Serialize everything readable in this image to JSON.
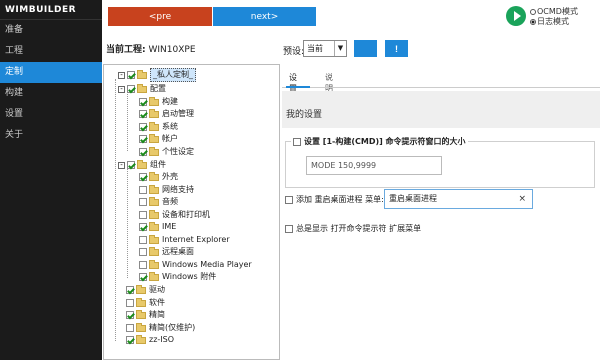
{
  "app": {
    "title": "WIMBUILDER"
  },
  "sidebar": {
    "items": [
      {
        "label": "准备",
        "active": false
      },
      {
        "label": "工程",
        "active": false
      },
      {
        "label": "定制",
        "active": true
      },
      {
        "label": "构建",
        "active": false
      },
      {
        "label": "设置",
        "active": false
      },
      {
        "label": "关于",
        "active": false
      }
    ]
  },
  "toolbar": {
    "pre_label": "<pre",
    "next_label": "next>",
    "project_label": "当前工程:",
    "project_value": "WIN10XPE",
    "preset_label": "预设:",
    "preset_value": "当前",
    "btn2_label": "!"
  },
  "mode": {
    "options": [
      {
        "label": "OCMD模式",
        "selected": false
      },
      {
        "label": "日志模式",
        "selected": true
      }
    ]
  },
  "tree": {
    "nodes": [
      {
        "label": "_私人定制_",
        "checked": true,
        "selected": true
      },
      {
        "label": "配置",
        "checked": true
      },
      {
        "label": "构建",
        "checked": true
      },
      {
        "label": "启动管理",
        "checked": true
      },
      {
        "label": "系统",
        "checked": true
      },
      {
        "label": "帐户",
        "checked": true
      },
      {
        "label": "个性设定",
        "checked": true
      },
      {
        "label": "组件",
        "checked": true
      },
      {
        "label": "外壳",
        "checked": true
      },
      {
        "label": "网络支持",
        "checked": false
      },
      {
        "label": "音频",
        "checked": false
      },
      {
        "label": "设备和打印机",
        "checked": false
      },
      {
        "label": "IME",
        "checked": true
      },
      {
        "label": "Internet Explorer",
        "checked": false
      },
      {
        "label": "远程桌面",
        "checked": false
      },
      {
        "label": "Windows Media Player",
        "checked": false
      },
      {
        "label": "Windows 附件",
        "checked": true
      },
      {
        "label": "驱动",
        "checked": true
      },
      {
        "label": "软件",
        "checked": false
      },
      {
        "label": "精简",
        "checked": true
      },
      {
        "label": "精简(仅维护)",
        "checked": false
      },
      {
        "label": "zz-ISO",
        "checked": true
      }
    ]
  },
  "panel": {
    "tabs": [
      {
        "label": "设置"
      },
      {
        "label": "说明"
      }
    ],
    "section_title": "我的设置",
    "group1": {
      "title": "设置 [1-构建(CMD)] 命令提示符窗口的大小",
      "value": "MODE 150,9999"
    },
    "row2": {
      "prefix": "添加 重启桌面进程 菜单:",
      "value": "重启桌面进程",
      "clear_glyph": "×"
    },
    "row3": {
      "label": "总是显示 打开命令提示符 扩展菜单"
    }
  }
}
